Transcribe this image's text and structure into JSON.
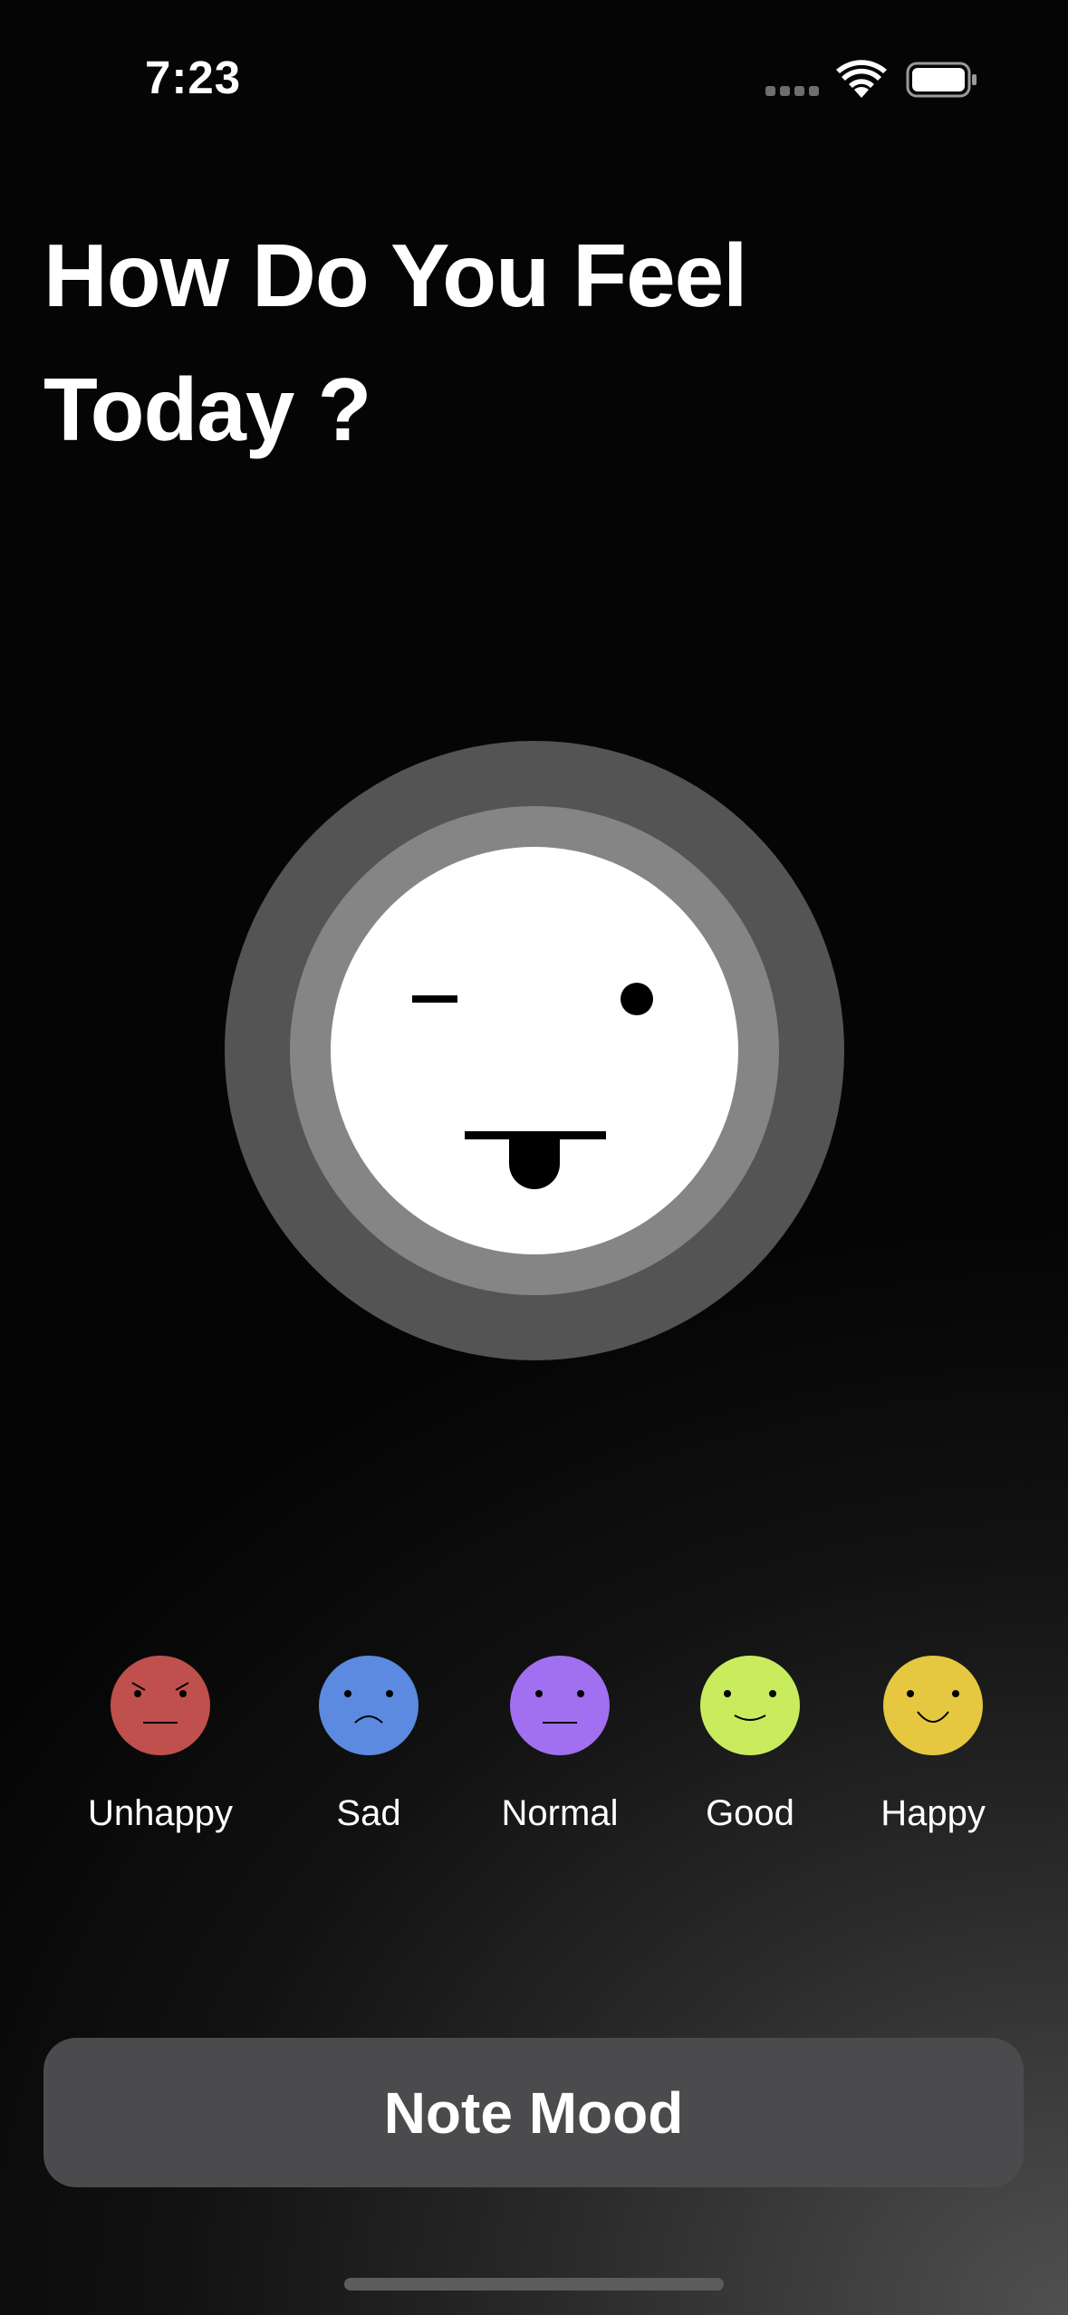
{
  "status_bar": {
    "time": "7:23",
    "icons": [
      "cellular-signal-icon",
      "wifi-icon",
      "battery-icon"
    ]
  },
  "header": {
    "title": "How Do You Feel Today ?"
  },
  "selected_mood": {
    "icon": "winking-tongue-face-icon",
    "colors": {
      "outer_ring": "#545454",
      "inner_ring": "#858585",
      "face": "#ffffff",
      "features": "#000000"
    }
  },
  "moods": [
    {
      "label": "Unhappy",
      "icon": "angry-face-icon",
      "color": "#c0504d"
    },
    {
      "label": "Sad",
      "icon": "sad-face-icon",
      "color": "#5b8ae0"
    },
    {
      "label": "Normal",
      "icon": "neutral-face-icon",
      "color": "#a070f0"
    },
    {
      "label": "Good",
      "icon": "slight-smile-face-icon",
      "color": "#c8ec5e"
    },
    {
      "label": "Happy",
      "icon": "smile-face-icon",
      "color": "#e6c840"
    }
  ],
  "actions": {
    "note_mood_label": "Note Mood",
    "button_color": "#4b4b4d"
  }
}
